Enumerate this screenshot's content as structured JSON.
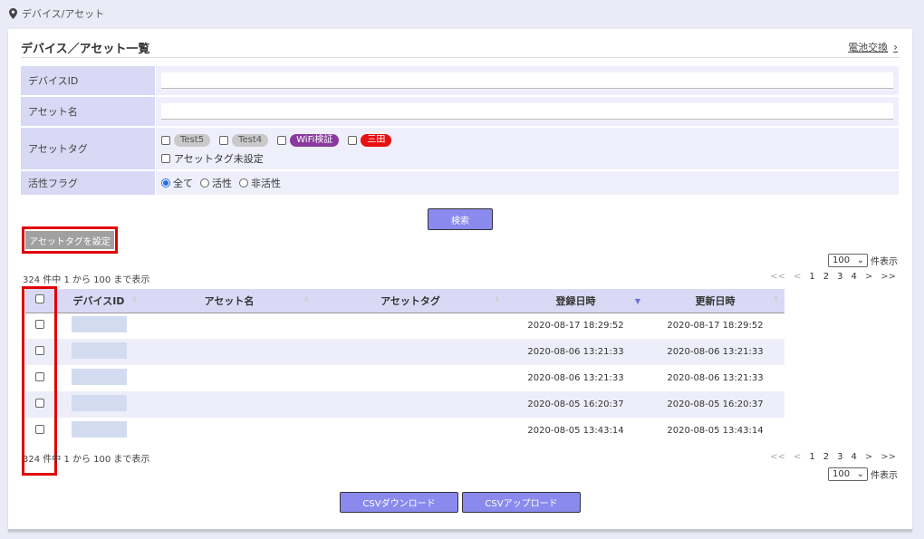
{
  "breadcrumb": {
    "icon": "location-pin-icon",
    "text": "デバイス/アセット"
  },
  "page_title": "デバイス／アセット一覧",
  "battery_link": {
    "label": "電池交換",
    "chevron": "›"
  },
  "filters": {
    "device_id": {
      "label": "デバイスID",
      "value": ""
    },
    "asset_name": {
      "label": "アセット名",
      "value": ""
    },
    "asset_tag": {
      "label": "アセットタグ",
      "tags": [
        {
          "name": "Test5",
          "color": "#c9c9c9",
          "checked": false
        },
        {
          "name": "Test4",
          "color": "#c9c9c9",
          "checked": false
        },
        {
          "name": "WiFi検証",
          "color": "#8a3a9e",
          "checked": false
        },
        {
          "name": "三田",
          "color": "#e81010",
          "checked": false
        }
      ],
      "unset_label": "アセットタグ未設定"
    },
    "active_flag": {
      "label": "活性フラグ",
      "options": [
        {
          "label": "全て",
          "selected": true
        },
        {
          "label": "活性",
          "selected": false
        },
        {
          "label": "非活性",
          "selected": false
        }
      ]
    }
  },
  "search_button": "検索",
  "set_tag_button": "アセットタグを設定",
  "pagination": {
    "per_page": "100",
    "per_page_suffix": "件表示",
    "count_text": "324 件中 1 から 100 まで表示",
    "first": "<<",
    "prev": "<",
    "pages": [
      "1",
      "2",
      "3",
      "4"
    ],
    "next": ">",
    "last": ">>"
  },
  "table": {
    "columns": [
      "",
      "デバイスID",
      "アセット名",
      "アセットタグ",
      "登録日時",
      "更新日時"
    ],
    "sort_column": "登録日時",
    "rows": [
      {
        "device_id": "",
        "asset_name": "",
        "asset_tag": "",
        "registered": "2020-08-17 18:29:52",
        "updated": "2020-08-17 18:29:52"
      },
      {
        "device_id": "",
        "asset_name": "",
        "asset_tag": "",
        "registered": "2020-08-06 13:21:33",
        "updated": "2020-08-06 13:21:33"
      },
      {
        "device_id": "",
        "asset_name": "",
        "asset_tag": "",
        "registered": "2020-08-06 13:21:33",
        "updated": "2020-08-06 13:21:33"
      },
      {
        "device_id": "",
        "asset_name": "",
        "asset_tag": "",
        "registered": "2020-08-05 16:20:37",
        "updated": "2020-08-05 16:20:37"
      },
      {
        "device_id": "",
        "asset_name": "",
        "asset_tag": "",
        "registered": "2020-08-05 13:43:14",
        "updated": "2020-08-05 13:43:14"
      }
    ]
  },
  "csv": {
    "download": "CSVダウンロード",
    "upload": "CSVアップロード"
  },
  "colors": {
    "accent": "#8a8aee",
    "header_bg": "#d9d9f5",
    "highlight": "#e00000"
  }
}
